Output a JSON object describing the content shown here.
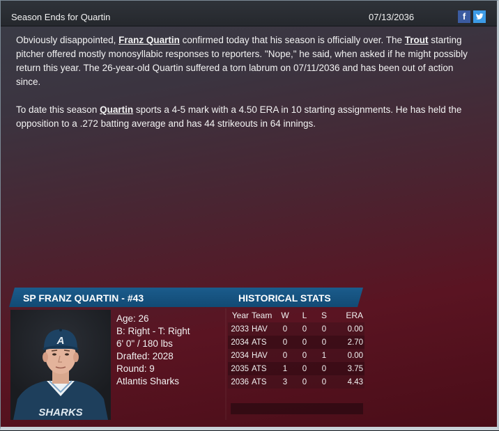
{
  "window": {
    "title": "Season Ends for Quartin",
    "date": "07/13/2036",
    "share": {
      "facebook": "f",
      "twitter": "t"
    }
  },
  "article": {
    "p1": {
      "t1": "Obviously disappointed, ",
      "link_player": "Franz Quartin",
      "t2": " confirmed today that his season is officially over. The ",
      "link_team": "Trout",
      "t3": " starting pitcher offered mostly monosyllabic responses to reporters. \"Nope,\" he said, when asked if he might possibly return this year. The 26-year-old Quartin suffered a torn labrum on 07/11/2036 and has been out of action since."
    },
    "p2": {
      "t1": "To date this season ",
      "link_player": "Quartin",
      "t2": " sports a 4-5 mark with a 4.50 ERA in 10 starting assignments. He has held the opposition to a .272 batting average and has 44 strikeouts in 64 innings."
    }
  },
  "player": {
    "header": "SP FRANZ QUARTIN - #43",
    "age": "Age: 26",
    "bats_throws": "B: Right - T: Right",
    "height_weight": "6' 0\" / 180 lbs",
    "drafted": "Drafted: 2028",
    "round": "Round: 9",
    "team": "Atlantis Sharks",
    "cap_letter": "A",
    "jersey_text": "SHARKS"
  },
  "stats": {
    "header": "HISTORICAL STATS",
    "columns": [
      "Year",
      "Team",
      "W",
      "L",
      "S",
      "ERA"
    ],
    "rows": [
      [
        "2033",
        "HAV",
        "0",
        "0",
        "0",
        "0.00"
      ],
      [
        "2034",
        "ATS",
        "0",
        "0",
        "0",
        "2.70"
      ],
      [
        "2034",
        "HAV",
        "0",
        "0",
        "1",
        "0.00"
      ],
      [
        "2035",
        "ATS",
        "1",
        "0",
        "0",
        "3.75"
      ],
      [
        "2036",
        "ATS",
        "3",
        "0",
        "0",
        "4.43"
      ]
    ]
  },
  "colors": {
    "header_blue": "#1b5c8c",
    "background_red": "#5a1422",
    "facebook": "#3b5ba0",
    "twitter": "#3c9be6"
  }
}
